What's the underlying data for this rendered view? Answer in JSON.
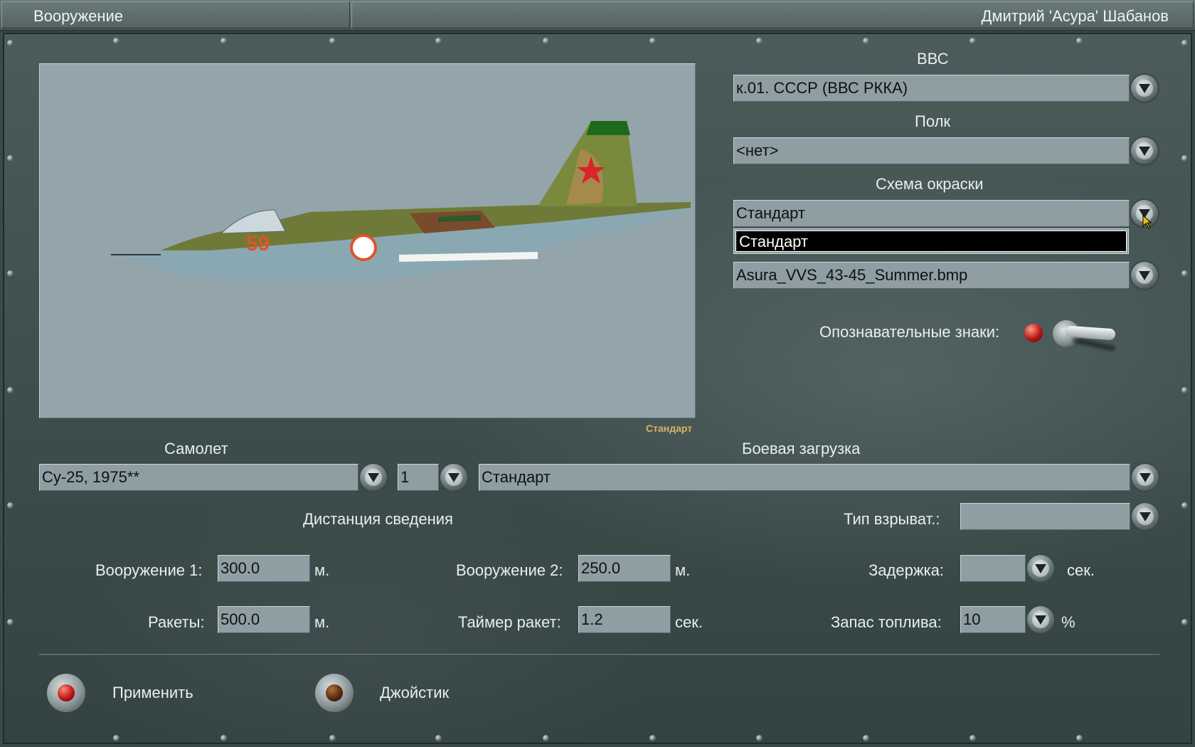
{
  "window": {
    "section_title": "Вооружение",
    "user_name": "Дмитрий 'Асура' Шабанов"
  },
  "preview": {
    "caption": "Стандарт"
  },
  "country": {
    "label": "ВВС",
    "value": "к.01. СССР (ВВС РККА)"
  },
  "regiment": {
    "label": "Полк",
    "value": "<нет>"
  },
  "paint_scheme": {
    "label": "Схема окраски",
    "value": "Стандарт",
    "dropdown_open_item": "Стандарт"
  },
  "skin_file": {
    "value": "Asura_VVS_43-45_Summer.bmp"
  },
  "markings": {
    "label": "Опознавательные знаки:",
    "toggle_on": true
  },
  "aircraft": {
    "label": "Самолет",
    "value": "Су-25, 1975**",
    "count": "1"
  },
  "loadout": {
    "label": "Боевая загрузка",
    "value": "Стандарт"
  },
  "convergence": {
    "heading": "Дистанция сведения",
    "weapon1_label": "Вооружение 1:",
    "weapon1_value": "300.0",
    "weapon1_unit": "м.",
    "weapon2_label": "Вооружение 2:",
    "weapon2_value": "250.0",
    "weapon2_unit": "м.",
    "rockets_label": "Ракеты:",
    "rockets_value": "500.0",
    "rockets_unit": "м.",
    "rocket_timer_label": "Таймер ракет:",
    "rocket_timer_value": "1.2",
    "rocket_timer_unit": "сек."
  },
  "fuze": {
    "type_label": "Тип взрыват.:",
    "type_value": "",
    "delay_label": "Задержка:",
    "delay_value": "",
    "delay_unit": "сек."
  },
  "fuel": {
    "label": "Запас топлива:",
    "value": "10",
    "unit": "%"
  },
  "actions": {
    "apply_label": "Применить",
    "joystick_label": "Джойстик"
  },
  "colors": {
    "field_bg": "#8e9ea3",
    "panel_bg": "#3d4d4c",
    "caption": "#d9b267",
    "apply_lamp": "#c01818",
    "joystick_lamp": "#5a2a10"
  }
}
